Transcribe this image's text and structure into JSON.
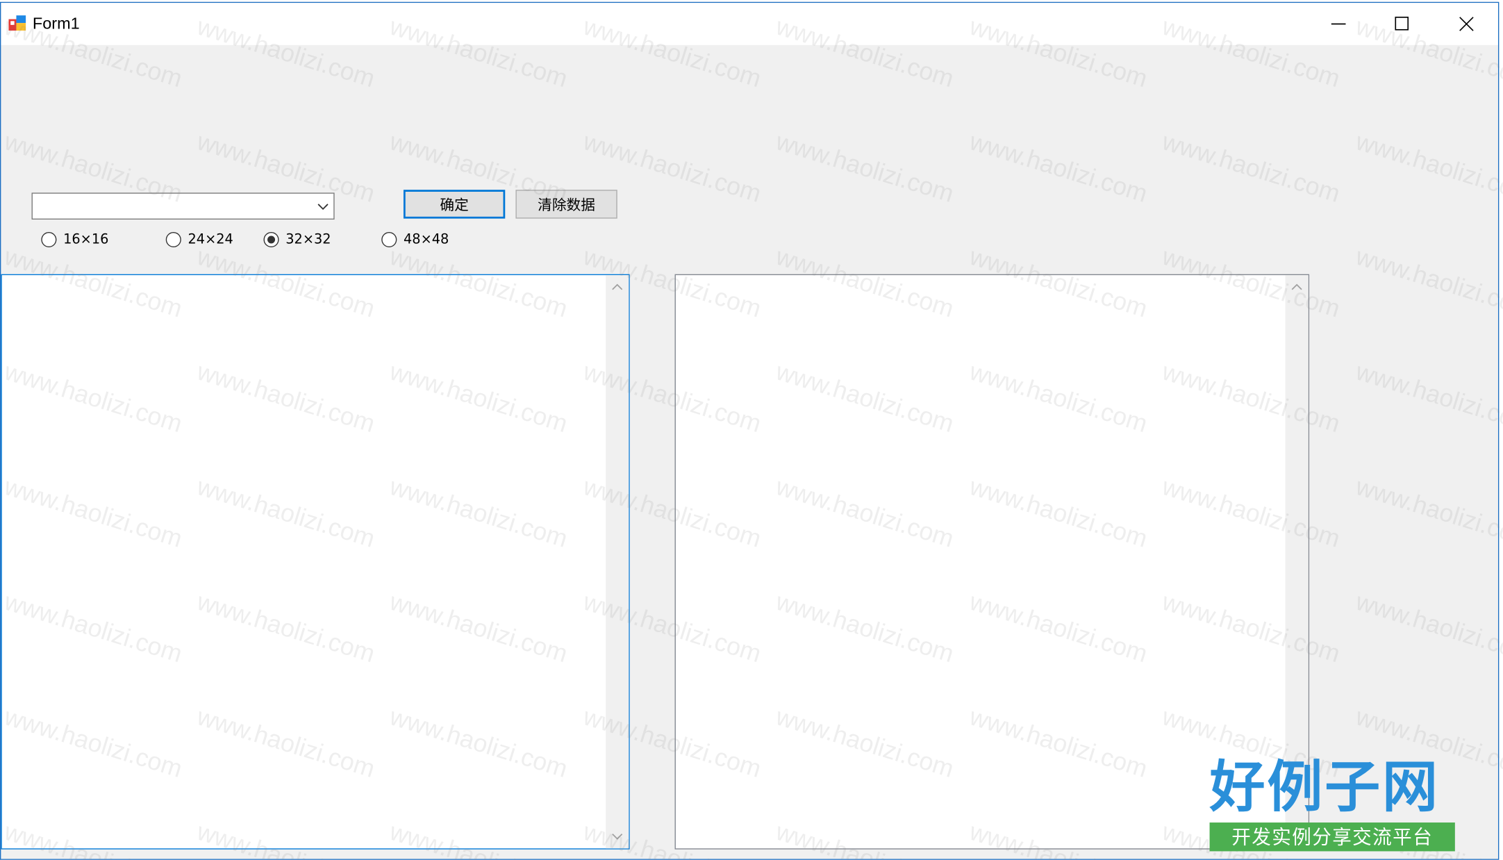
{
  "window": {
    "title": "Form1"
  },
  "combo": {
    "value": ""
  },
  "buttons": {
    "ok_label": "确定",
    "clear_label": "清除数据"
  },
  "radios": [
    {
      "label": "16×16",
      "checked": false
    },
    {
      "label": "24×24",
      "checked": false
    },
    {
      "label": "32×32",
      "checked": true
    },
    {
      "label": "48×48",
      "checked": false
    }
  ],
  "watermark": {
    "text": "www.haolizi.com"
  },
  "logo": {
    "main": "好例子网",
    "sub": "开发实例分享交流平台"
  },
  "colors": {
    "accent": "#0078d7",
    "window_bg": "#f0f0f0",
    "logo_blue": "#2a8fd9",
    "logo_green": "#4caf50"
  }
}
